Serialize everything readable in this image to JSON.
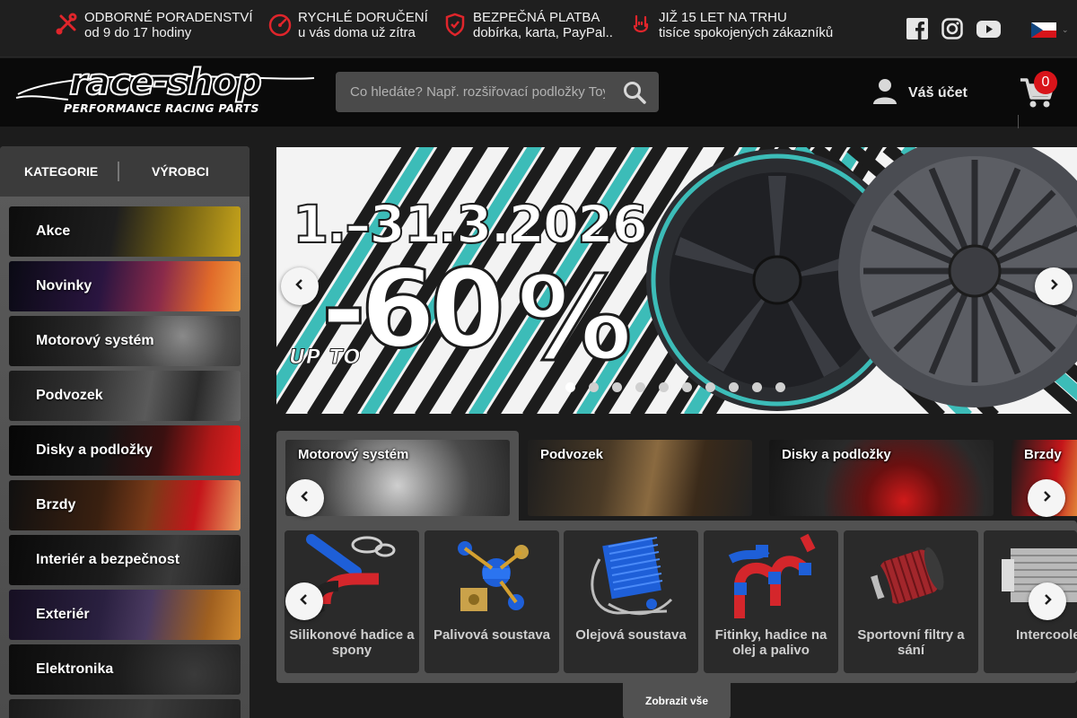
{
  "infobar": {
    "items": [
      {
        "title": "ODBORNÉ PORADENSTVÍ",
        "subtitle": "od 9 do 17 hodiny",
        "icon": "tools-icon"
      },
      {
        "title": "RYCHLÉ DORUČENÍ",
        "subtitle": "u vás doma už zítra",
        "icon": "speedometer-icon"
      },
      {
        "title": "BEZPEČNÁ PLATBA",
        "subtitle": "dobírka, karta, PayPal..",
        "icon": "shield-check-icon"
      },
      {
        "title": "JIŽ 15 LET NA TRHU",
        "subtitle": "tisíce spokojených zákazníků",
        "icon": "rock-hand-icon"
      }
    ],
    "social": [
      "facebook-icon",
      "instagram-icon",
      "youtube-icon"
    ],
    "language": "CZ"
  },
  "header": {
    "logo_text": "race-shop",
    "logo_tagline": "PERFORMANCE RACING PARTS",
    "search_placeholder": "Co hledáte? Např. rozšiřovací podložky Toyota",
    "account_label": "Váš účet",
    "cart_count": "0"
  },
  "sidebar": {
    "tabs": [
      "KATEGORIE",
      "VÝROBCI"
    ],
    "categories": [
      "Akce",
      "Novinky",
      "Motorový systém",
      "Podvozek",
      "Disky a podložky",
      "Brzdy",
      "Interiér a bezpečnost",
      "Exteriér",
      "Elektronika"
    ]
  },
  "banner": {
    "date_text": "1.–31.3.2026",
    "upto_text": "UP TO",
    "discount_text": "-60",
    "percent_glyph": "%",
    "slide_count": 10,
    "active_slide": 0
  },
  "categories_strip": [
    "Motorový systém",
    "Podvozek",
    "Disky a podložky",
    "Brzdy"
  ],
  "subcategories": [
    "Silikonové hadice a spony",
    "Palivová soustava",
    "Olejová soustava",
    "Fitinky, hadice na olej a palivo",
    "Sportovní filtry a sání",
    "Intercooler"
  ],
  "show_all_label": "Zobrazit vše",
  "colors": {
    "accent_red": "#d8141a",
    "teal": "#3cbcb8",
    "header_bg": "#0a0a0a"
  }
}
